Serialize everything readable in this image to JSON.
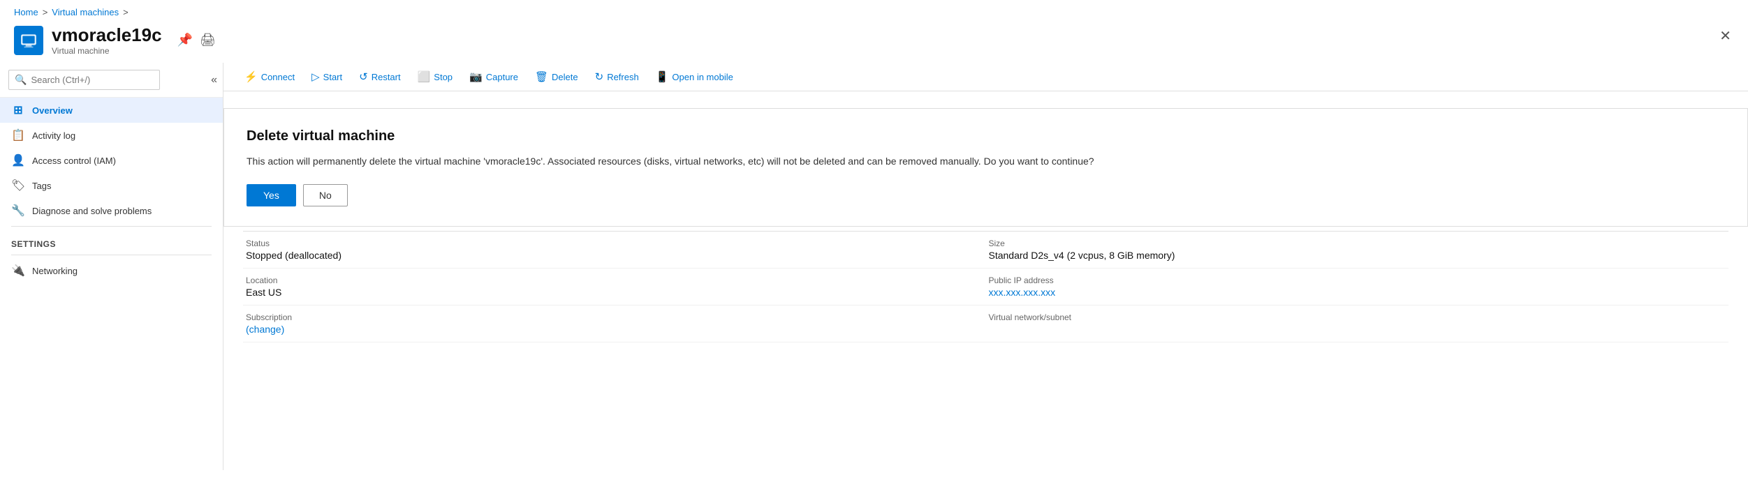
{
  "breadcrumb": {
    "home": "Home",
    "separator1": ">",
    "vms": "Virtual machines",
    "separator2": ">"
  },
  "header": {
    "vm_name": "vmoracle19c",
    "vm_type": "Virtual machine",
    "pin_icon": "📌",
    "print_icon": "🖨"
  },
  "toolbar": {
    "connect": "Connect",
    "start": "Start",
    "restart": "Restart",
    "stop": "Stop",
    "capture": "Capture",
    "delete": "Delete",
    "refresh": "Refresh",
    "open_mobile": "Open in mobile"
  },
  "sidebar": {
    "search_placeholder": "Search (Ctrl+/)",
    "nav_items": [
      {
        "id": "overview",
        "label": "Overview",
        "icon": "⊞",
        "active": true
      },
      {
        "id": "activity-log",
        "label": "Activity log",
        "icon": "📋",
        "active": false
      },
      {
        "id": "access-control",
        "label": "Access control (IAM)",
        "icon": "👤",
        "active": false
      },
      {
        "id": "tags",
        "label": "Tags",
        "icon": "🏷",
        "active": false
      },
      {
        "id": "diagnose",
        "label": "Diagnose and solve problems",
        "icon": "🔧",
        "active": false
      }
    ],
    "settings_section": "Settings",
    "settings_items": [
      {
        "id": "networking",
        "label": "Networking",
        "icon": "🔌",
        "active": false
      }
    ]
  },
  "dialog": {
    "title": "Delete virtual machine",
    "message": "This action will permanently delete the virtual machine 'vmoracle19c'. Associated resources (disks, virtual networks, etc) will not be deleted and can be removed manually. Do you want to continue?",
    "yes_label": "Yes",
    "no_label": "No"
  },
  "vm_info": {
    "status_label": "Status",
    "status_value": "Stopped (deallocated)",
    "size_label": "Size",
    "size_value": "Standard D2s_v4 (2 vcpus, 8 GiB memory)",
    "location_label": "Location",
    "location_value": "East US",
    "public_ip_label": "Public IP address",
    "public_ip_value": "xxx.xxx.xxx.xxx",
    "subscription_label": "Subscription",
    "subscription_change": "(change)",
    "vnet_label": "Virtual network/subnet"
  }
}
